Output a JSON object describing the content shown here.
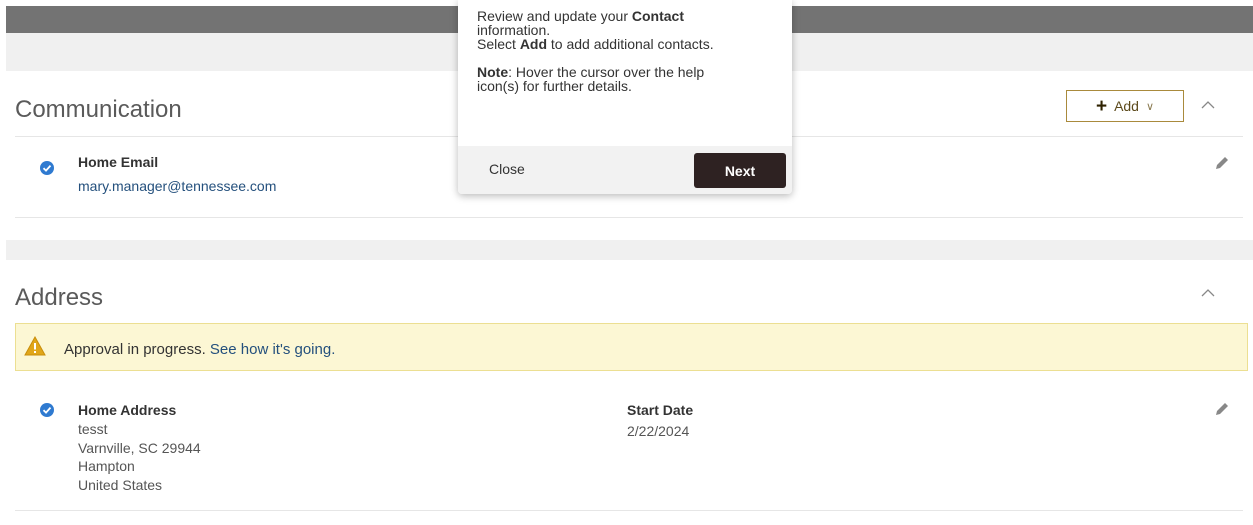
{
  "communication": {
    "title": "Communication",
    "add_button": {
      "label": "Add"
    },
    "items": [
      {
        "label": "Home Email",
        "value": "mary.manager@tennessee.com"
      }
    ]
  },
  "address": {
    "title": "Address",
    "approval": {
      "text": "Approval in progress.",
      "link": "See how it's going."
    },
    "items": [
      {
        "label": "Home Address",
        "lines": [
          "tesst",
          "Varnville, SC 29944",
          "Hampton",
          "United States"
        ],
        "start_date_label": "Start Date",
        "start_date": "2/22/2024"
      }
    ]
  },
  "popover": {
    "line1_pre": "Review and update your ",
    "line1_bold": "Contact",
    "line2": "information.",
    "line3_pre": "Select ",
    "line3_bold": "Add",
    "line3_post": " to add additional contacts.",
    "note_bold": "Note",
    "note_line1": ": Hover the cursor over the help",
    "note_line2": "icon(s) for further details.",
    "close_label": "Close",
    "next_label": "Next"
  },
  "colors": {
    "accent_gold": "#a98a3c",
    "link_blue": "#24507d",
    "check_blue": "#2f7ad0",
    "next_button": "#2e2222",
    "banner_bg": "#fcf7d4"
  }
}
